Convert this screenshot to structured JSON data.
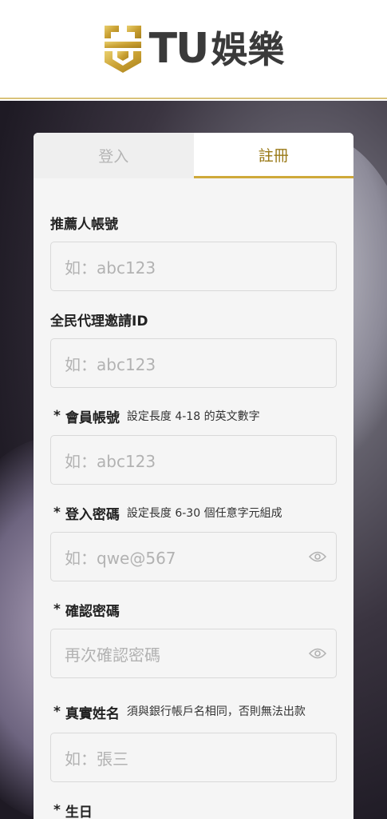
{
  "brand": {
    "name_latin": "TU",
    "name_cjk": "娛樂",
    "accent": "#cfa93a",
    "shield_icon": "gold-shield-logo-icon"
  },
  "tabs": [
    {
      "label": "登入",
      "active": false
    },
    {
      "label": "註冊",
      "active": true
    }
  ],
  "fields": [
    {
      "label": "推薦人帳號",
      "required": false,
      "hint": "",
      "placeholder": "如：abc123",
      "has_eye": false
    },
    {
      "label": "全民代理邀請ID",
      "required": false,
      "hint": "",
      "placeholder": "如：abc123",
      "has_eye": false
    },
    {
      "label": "會員帳號",
      "required": true,
      "hint": "設定長度 4-18 的英文數字",
      "placeholder": "如：abc123",
      "has_eye": false
    },
    {
      "label": "登入密碼",
      "required": true,
      "hint": "設定長度 6-30 個任意字元組成",
      "placeholder": "如：qwe@567",
      "has_eye": true
    },
    {
      "label": "確認密碼",
      "required": true,
      "hint": "",
      "placeholder": "再次確認密碼",
      "has_eye": true
    },
    {
      "label": "真實姓名",
      "required": true,
      "hint": "須與銀行帳戶名相同，否則無法出款",
      "placeholder": "如：張三",
      "has_eye": false
    },
    {
      "label": "生日",
      "required": true,
      "hint": "",
      "placeholder": "",
      "has_eye": false
    }
  ],
  "required_marker": "*"
}
